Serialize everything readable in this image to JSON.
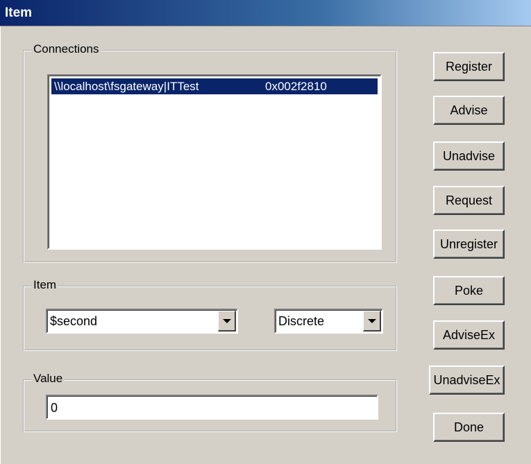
{
  "window": {
    "title": "Item"
  },
  "connections": {
    "label": "Connections",
    "items": [
      {
        "path": "\\\\localhost\\fsgateway|ITTest",
        "handle": "0x002f2810",
        "selected": true
      }
    ]
  },
  "item": {
    "label": "Item",
    "name_value": "$second",
    "type_value": "Discrete"
  },
  "value": {
    "label": "Value",
    "text": "0"
  },
  "buttons": {
    "register": "Register",
    "advise": "Advise",
    "unadvise": "Unadvise",
    "request": "Request",
    "unregister": "Unregister",
    "poke": "Poke",
    "adviseex": "AdviseEx",
    "unadviseex": "UnadviseEx",
    "done": "Done"
  },
  "colors": {
    "titlebar_start": "#0a246a",
    "titlebar_end": "#a6caf0",
    "selection": "#0a246a",
    "face": "#d4d0c8"
  }
}
